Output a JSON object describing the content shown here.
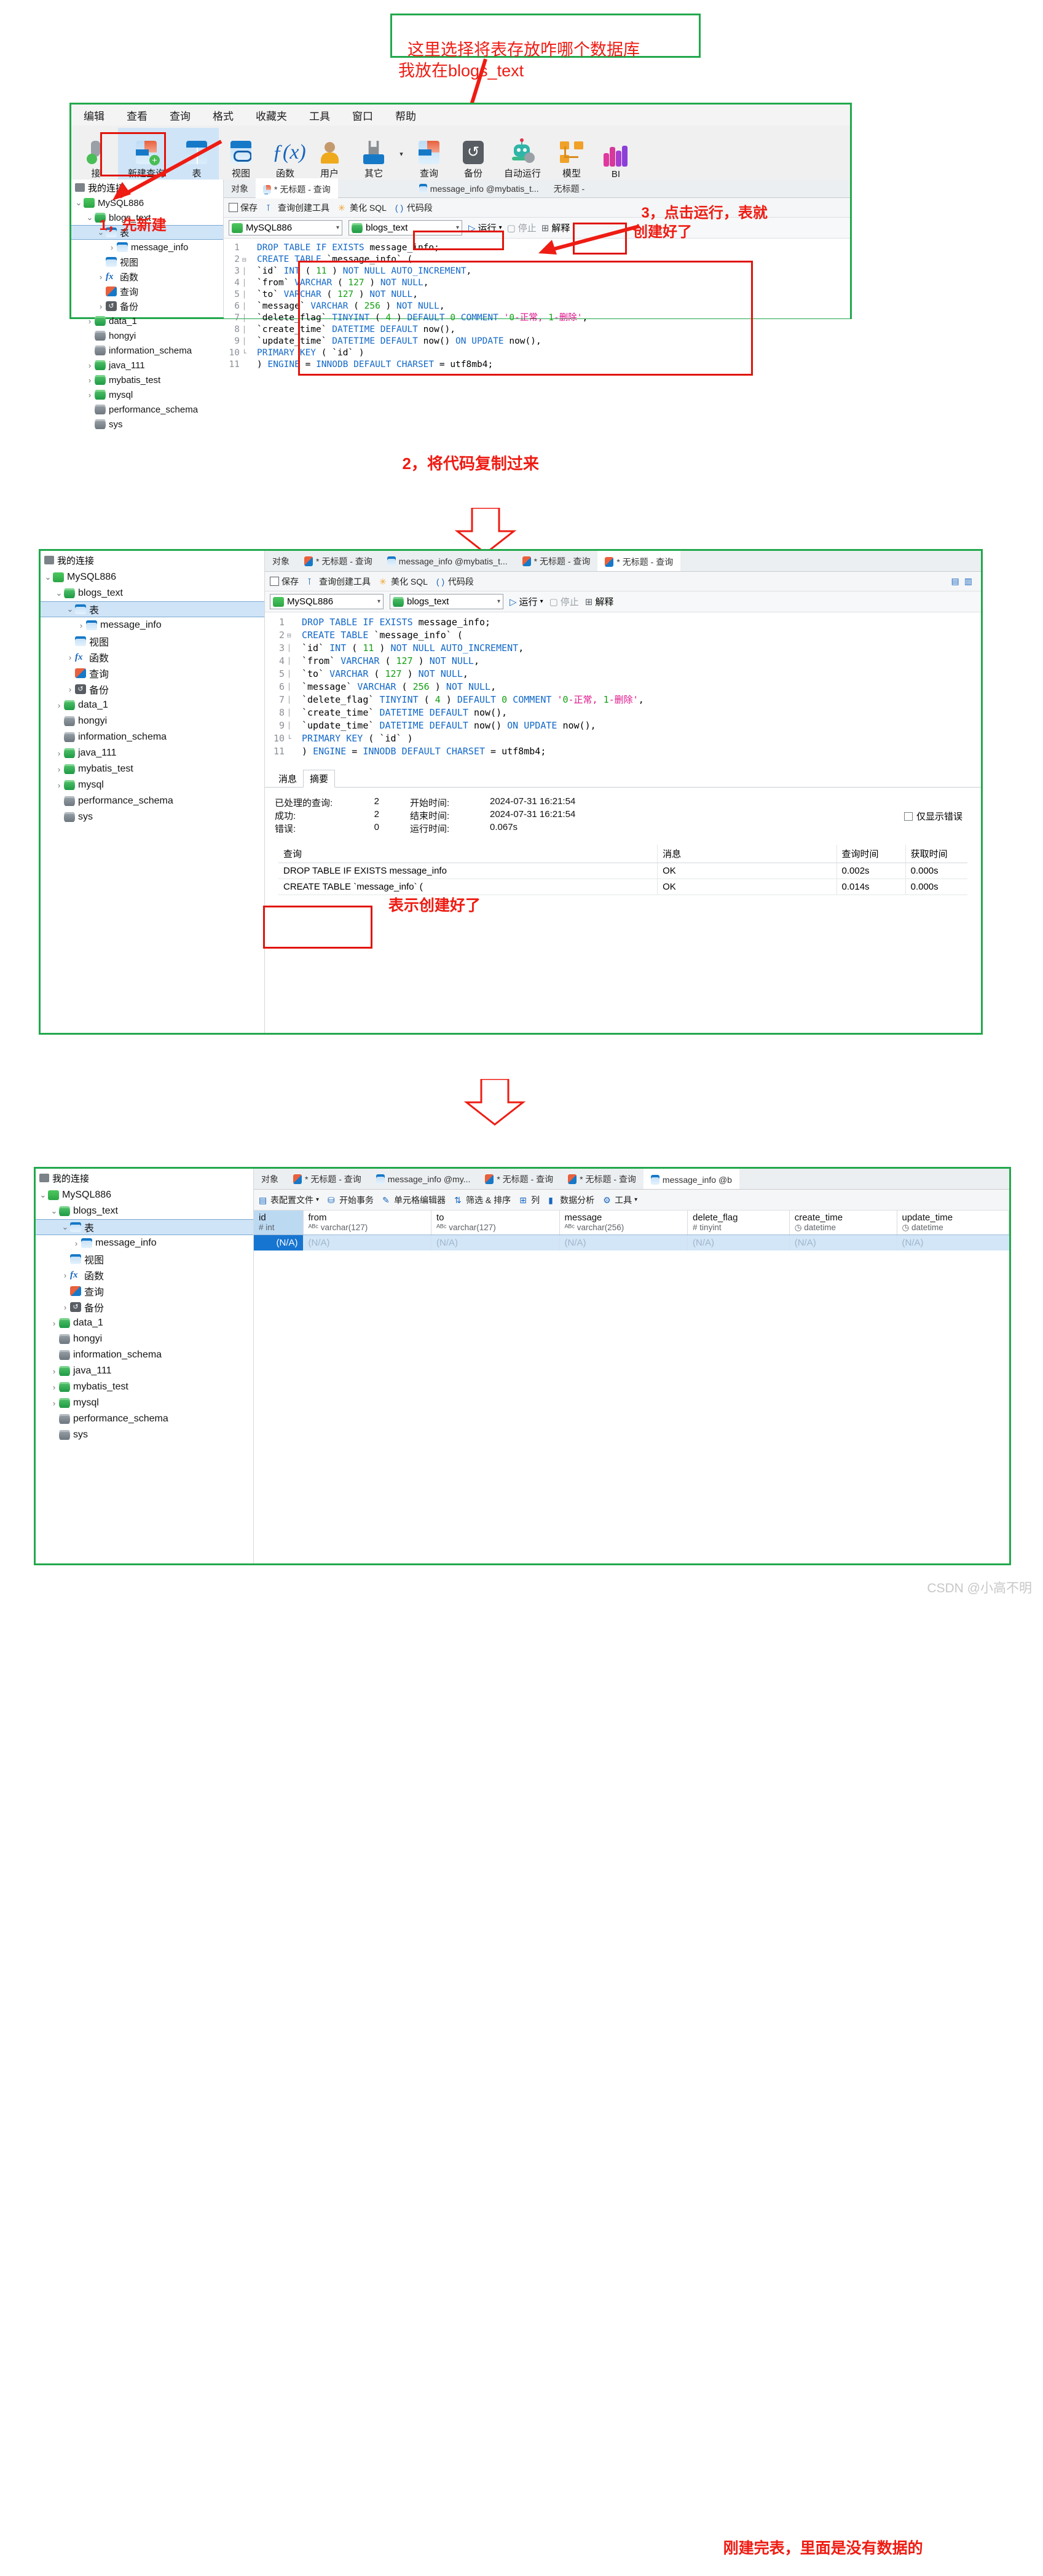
{
  "annotations": {
    "top_box": "这里选择将表存放咋哪个数据库\n我放在blogs_text",
    "step1": "1，先新建",
    "step2": "2，将代码复制过来",
    "step3": "3，点击运行，表就\n创建好了",
    "created_ok": "表示创建好了",
    "empty_table": "刚建完表，里面是没有数据的"
  },
  "watermark": "CSDN @小高不明",
  "menubar": [
    "编辑",
    "查看",
    "查询",
    "格式",
    "收藏夹",
    "工具",
    "窗口",
    "帮助"
  ],
  "ribbon": [
    {
      "label": "接",
      "icon": "connection-icon"
    },
    {
      "label": "新建查询",
      "icon": "new-query-icon"
    },
    {
      "label": "表",
      "icon": "table-icon"
    },
    {
      "label": "视图",
      "icon": "view-icon"
    },
    {
      "label": "函数",
      "icon": "function-icon"
    },
    {
      "label": "用户",
      "icon": "user-icon"
    },
    {
      "label": "其它",
      "icon": "other-icon"
    },
    {
      "label": "查询",
      "icon": "query-icon"
    },
    {
      "label": "备份",
      "icon": "backup-icon"
    },
    {
      "label": "自动运行",
      "icon": "automation-icon"
    },
    {
      "label": "模型",
      "icon": "model-icon"
    },
    {
      "label": "BI",
      "icon": "bi-icon"
    }
  ],
  "sidebar": {
    "header": "我的连接",
    "tree": [
      {
        "label": "MySQL886",
        "indent": 0,
        "caret": "v",
        "icon": "mysql-icon"
      },
      {
        "label": "blogs_text",
        "indent": 1,
        "caret": "v",
        "icon": "db-green-icon"
      },
      {
        "label": "表",
        "indent": 2,
        "caret": "v",
        "icon": "table-icon",
        "selected": true
      },
      {
        "label": "message_info",
        "indent": 3,
        "caret": ">",
        "icon": "table-icon"
      },
      {
        "label": "视图",
        "indent": 2,
        "caret": "",
        "icon": "view-icon"
      },
      {
        "label": "函数",
        "indent": 2,
        "caret": ">",
        "icon": "function-icon"
      },
      {
        "label": "查询",
        "indent": 2,
        "caret": "",
        "icon": "query-icon"
      },
      {
        "label": "备份",
        "indent": 2,
        "caret": ">",
        "icon": "backup-icon"
      },
      {
        "label": "data_1",
        "indent": 1,
        "caret": ">",
        "icon": "db-green-icon"
      },
      {
        "label": "hongyi",
        "indent": 1,
        "caret": "",
        "icon": "db-gray-icon"
      },
      {
        "label": "information_schema",
        "indent": 1,
        "caret": "",
        "icon": "db-gray-icon"
      },
      {
        "label": "java_111",
        "indent": 1,
        "caret": ">",
        "icon": "db-green-icon"
      },
      {
        "label": "mybatis_test",
        "indent": 1,
        "caret": ">",
        "icon": "db-green-icon"
      },
      {
        "label": "mysql",
        "indent": 1,
        "caret": ">",
        "icon": "db-green-icon"
      },
      {
        "label": "performance_schema",
        "indent": 1,
        "caret": "",
        "icon": "db-gray-icon"
      },
      {
        "label": "sys",
        "indent": 1,
        "caret": "",
        "icon": "db-gray-icon"
      }
    ]
  },
  "tabs": {
    "objects": "对象",
    "items": [
      {
        "label": "* 无标题 - 查询",
        "icon": "query-icon"
      },
      {
        "label": "message_info @mybatis_t...",
        "icon": "table-icon"
      },
      {
        "label": "* 无标题 - 查询",
        "icon": "query-icon"
      },
      {
        "label": "* 无标题 - 查询",
        "icon": "query-icon",
        "active": true
      }
    ],
    "items_short": [
      {
        "label": "* 无标题 - 查询",
        "icon": "query-icon"
      },
      {
        "label": "message_info @my...",
        "icon": "table-icon"
      },
      {
        "label": "* 无标题 - 查询",
        "icon": "query-icon"
      },
      {
        "label": "* 无标题 - 查询",
        "icon": "query-icon"
      },
      {
        "label": "message_info @b",
        "icon": "table-icon",
        "active": true
      }
    ],
    "top_panel": [
      {
        "label": "* 无标题 - 查询",
        "icon": "query-icon"
      },
      {
        "label": "message_info @mybatis_t...",
        "icon": "table-icon"
      },
      {
        "label": "无标题 -",
        "icon": "query-icon"
      }
    ]
  },
  "query_toolbar": {
    "save": "保存",
    "builder": "查询创建工具",
    "beautify": "美化 SQL",
    "snippet": "代码段"
  },
  "selectors": {
    "connection": "MySQL886",
    "database": "blogs_text",
    "run": "运行",
    "stop": "停止",
    "explain": "解释"
  },
  "sql": {
    "lines": [
      {
        "n": 1,
        "text": "DROP TABLE IF EXISTS message_info;"
      },
      {
        "n": 2,
        "text": "CREATE TABLE `message_info` ("
      },
      {
        "n": 3,
        "text": "`id` INT ( 11 ) NOT NULL AUTO_INCREMENT,"
      },
      {
        "n": 4,
        "text": "`from` VARCHAR ( 127 ) NOT NULL,"
      },
      {
        "n": 5,
        "text": "`to` VARCHAR ( 127 ) NOT NULL,"
      },
      {
        "n": 6,
        "text": "`message` VARCHAR ( 256 ) NOT NULL,"
      },
      {
        "n": 7,
        "text": "`delete_flag` TINYINT ( 4 ) DEFAULT 0 COMMENT '0-正常, 1-删除',"
      },
      {
        "n": 8,
        "text": "`create_time` DATETIME DEFAULT now(),"
      },
      {
        "n": 9,
        "text": "`update_time` DATETIME DEFAULT now() ON UPDATE now(),"
      },
      {
        "n": 10,
        "text": "PRIMARY KEY ( `id` )"
      },
      {
        "n": 11,
        "text": ") ENGINE = INNODB DEFAULT CHARSET = utf8mb4;"
      }
    ]
  },
  "result_panel": {
    "tabs": [
      "消息",
      "摘要"
    ],
    "active_tab": "摘要",
    "summary_left": [
      {
        "key": "已处理的查询:",
        "value": "2"
      },
      {
        "key": "成功:",
        "value": "2"
      },
      {
        "key": "错误:",
        "value": "0"
      }
    ],
    "summary_right": [
      {
        "key": "开始时间:",
        "value": "2024-07-31 16:21:54"
      },
      {
        "key": "结束时间:",
        "value": "2024-07-31 16:21:54"
      },
      {
        "key": "运行时间:",
        "value": "0.067s"
      }
    ],
    "only_errors": "仅显示错误",
    "table": {
      "headers": [
        "查询",
        "消息",
        "查询时间",
        "获取时间"
      ],
      "rows": [
        [
          "DROP TABLE IF EXISTS message_info",
          "OK",
          "0.002s",
          "0.000s"
        ],
        [
          "CREATE TABLE `message_info` (",
          "OK",
          "0.014s",
          "0.000s"
        ]
      ]
    }
  },
  "data_panel": {
    "toolbar": [
      {
        "label": "表配置文件",
        "icon": "table-profile-icon",
        "caret": true
      },
      {
        "label": "开始事务",
        "icon": "transaction-icon"
      },
      {
        "label": "单元格编辑器",
        "icon": "cell-editor-icon"
      },
      {
        "label": "筛选 & 排序",
        "icon": "filter-sort-icon"
      },
      {
        "label": "列",
        "icon": "columns-icon"
      },
      {
        "label": "数据分析",
        "icon": "data-analysis-icon"
      },
      {
        "label": "工具",
        "icon": "tools-icon",
        "caret": true
      }
    ],
    "columns": [
      {
        "name": "id",
        "type": "int",
        "marker": "#"
      },
      {
        "name": "from",
        "type": "varchar(127)",
        "marker": "ABC"
      },
      {
        "name": "to",
        "type": "varchar(127)",
        "marker": "ABC"
      },
      {
        "name": "message",
        "type": "varchar(256)",
        "marker": "ABC"
      },
      {
        "name": "delete_flag",
        "type": "tinyint",
        "marker": "#"
      },
      {
        "name": "create_time",
        "type": "datetime",
        "marker": "clock"
      },
      {
        "name": "update_time",
        "type": "datetime",
        "marker": "clock"
      }
    ],
    "row": [
      "(N/A)",
      "(N/A)",
      "(N/A)",
      "(N/A)",
      "(N/A)",
      "(N/A)",
      "(N/A)"
    ]
  }
}
